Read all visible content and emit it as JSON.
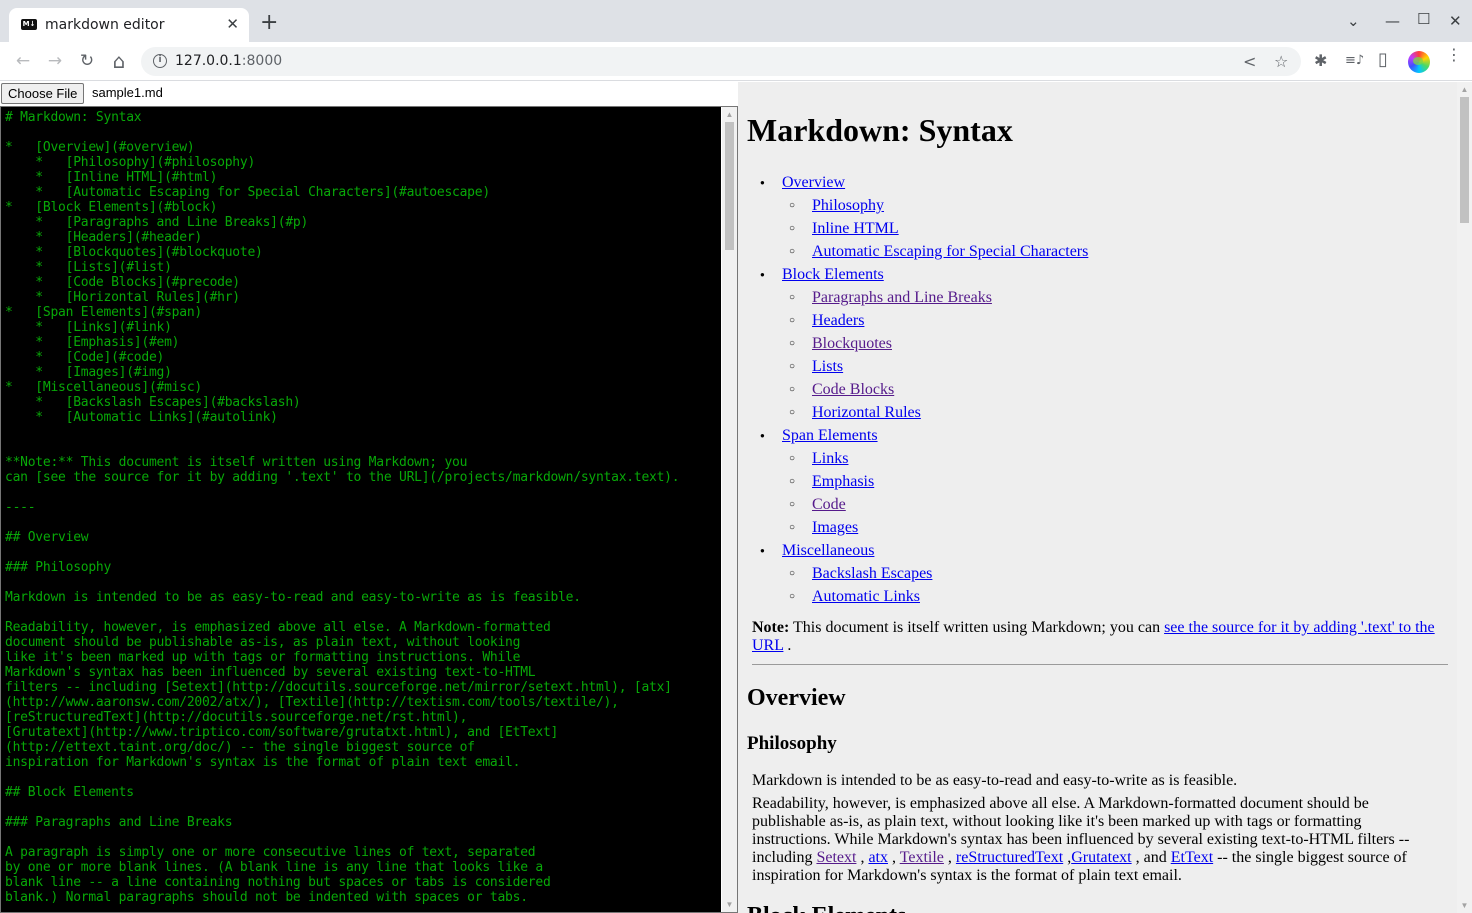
{
  "browser": {
    "tab_title": "markdown editor",
    "tab_favicon": "M↓",
    "new_tab_label": "+",
    "url_host": "127.0.0.1",
    "url_port": ":8000",
    "icons": {
      "back": "←",
      "forward": "→",
      "reload": "↻",
      "home": "⌂",
      "info": "i",
      "share": "<",
      "bookmark": "☆",
      "extensions": "✱",
      "media": "≡♪",
      "sidepanel": "▯",
      "menu": "⋮",
      "tab_close": "✕",
      "tab_search": "⌄",
      "minimize": "—",
      "maximize": "☐",
      "close": "✕"
    }
  },
  "file_input": {
    "button_label": "Choose File",
    "file_name": "sample1.md"
  },
  "editor": {
    "lines": [
      "# Markdown: Syntax",
      "",
      "*   [Overview](#overview)",
      "    *   [Philosophy](#philosophy)",
      "    *   [Inline HTML](#html)",
      "    *   [Automatic Escaping for Special Characters](#autoescape)",
      "*   [Block Elements](#block)",
      "    *   [Paragraphs and Line Breaks](#p)",
      "    *   [Headers](#header)",
      "    *   [Blockquotes](#blockquote)",
      "    *   [Lists](#list)",
      "    *   [Code Blocks](#precode)",
      "    *   [Horizontal Rules](#hr)",
      "*   [Span Elements](#span)",
      "    *   [Links](#link)",
      "    *   [Emphasis](#em)",
      "    *   [Code](#code)",
      "    *   [Images](#img)",
      "*   [Miscellaneous](#misc)",
      "    *   [Backslash Escapes](#backslash)",
      "    *   [Automatic Links](#autolink)",
      "",
      "",
      "**Note:** This document is itself written using Markdown; you",
      "can [see the source for it by adding '.text' to the URL](/projects/markdown/syntax.text).",
      "",
      "----",
      "",
      "## Overview",
      "",
      "### Philosophy",
      "",
      "Markdown is intended to be as easy-to-read and easy-to-write as is feasible.",
      "",
      "Readability, however, is emphasized above all else. A Markdown-formatted",
      "document should be publishable as-is, as plain text, without looking",
      "like it's been marked up with tags or formatting instructions. While",
      "Markdown's syntax has been influenced by several existing text-to-HTML",
      "filters -- including [Setext](http://docutils.sourceforge.net/mirror/setext.html), [atx]",
      "(http://www.aaronsw.com/2002/atx/), [Textile](http://textism.com/tools/textile/),",
      "[reStructuredText](http://docutils.sourceforge.net/rst.html),",
      "[Grutatext](http://www.triptico.com/software/grutatxt.html), and [EtText]",
      "(http://ettext.taint.org/doc/) -- the single biggest source of",
      "inspiration for Markdown's syntax is the format of plain text email.",
      "",
      "## Block Elements",
      "",
      "### Paragraphs and Line Breaks",
      "",
      "A paragraph is simply one or more consecutive lines of text, separated",
      "by one or more blank lines. (A blank line is any line that looks like a",
      "blank line -- a line containing nothing but spaces or tabs is considered",
      "blank.) Normal paragraphs should not be indented with spaces or tabs."
    ]
  },
  "preview": {
    "title": "Markdown: Syntax",
    "toc": [
      {
        "level": 1,
        "label": "Overview",
        "visited": false
      },
      {
        "level": 2,
        "label": "Philosophy",
        "visited": false
      },
      {
        "level": 2,
        "label": "Inline HTML",
        "visited": false
      },
      {
        "level": 2,
        "label": "Automatic Escaping for Special Characters",
        "visited": false
      },
      {
        "level": 1,
        "label": "Block Elements",
        "visited": false
      },
      {
        "level": 2,
        "label": "Paragraphs and Line Breaks",
        "visited": true
      },
      {
        "level": 2,
        "label": "Headers",
        "visited": false
      },
      {
        "level": 2,
        "label": "Blockquotes",
        "visited": true
      },
      {
        "level": 2,
        "label": "Lists",
        "visited": false
      },
      {
        "level": 2,
        "label": "Code Blocks",
        "visited": true
      },
      {
        "level": 2,
        "label": "Horizontal Rules",
        "visited": false
      },
      {
        "level": 1,
        "label": "Span Elements",
        "visited": false
      },
      {
        "level": 2,
        "label": "Links",
        "visited": false
      },
      {
        "level": 2,
        "label": "Emphasis",
        "visited": false
      },
      {
        "level": 2,
        "label": "Code",
        "visited": true
      },
      {
        "level": 2,
        "label": "Images",
        "visited": false
      },
      {
        "level": 1,
        "label": "Miscellaneous",
        "visited": false
      },
      {
        "level": 2,
        "label": "Backslash Escapes",
        "visited": false
      },
      {
        "level": 2,
        "label": "Automatic Links",
        "visited": false
      }
    ],
    "note": {
      "bold": "Note:",
      "text": " This document is itself written using Markdown; you can ",
      "link": "see the source for it by adding '.text' to the URL",
      "after": " ."
    },
    "overview_heading": "Overview",
    "philosophy_heading": "Philosophy",
    "para1": "Markdown is intended to be as easy-to-read and easy-to-write as is feasible.",
    "para2": {
      "before": "Readability, however, is emphasized above all else. A Markdown-formatted document should be publishable as-is, as plain text, without looking like it's been marked up with tags or formatting instructions. While Markdown's syntax has been influenced by several existing text-to-HTML filters -- including ",
      "links": [
        {
          "label": "Setext",
          "visited": true,
          "after": " , "
        },
        {
          "label": "atx",
          "visited": false,
          "after": " , "
        },
        {
          "label": "Textile",
          "visited": true,
          "after": " , "
        },
        {
          "label": "reStructuredText",
          "visited": false,
          "after": " ,"
        },
        {
          "label": "Grutatext",
          "visited": false,
          "after": " , and "
        },
        {
          "label": "EtText",
          "visited": false,
          "after": " -- the single biggest source of inspiration for Markdown's syntax is the format of plain text email."
        }
      ]
    },
    "block_heading": "Block Elements"
  },
  "colors": {
    "editor_bg": "#000000",
    "editor_text": "#08a808",
    "preview_bg": "#eeeeee",
    "link": "#0000ee",
    "visited_link": "#551a8b"
  }
}
